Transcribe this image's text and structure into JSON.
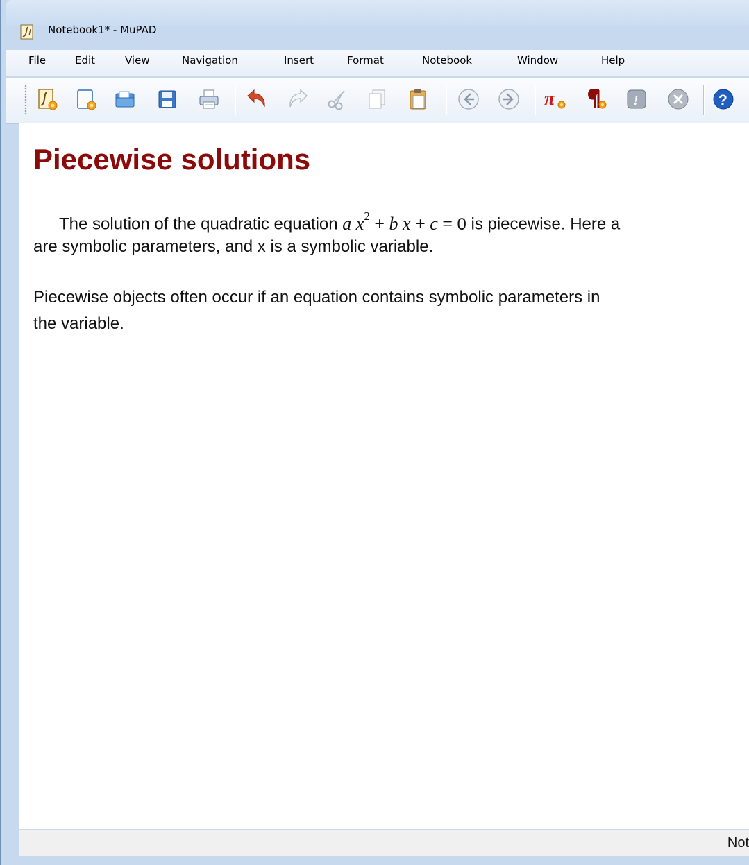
{
  "window": {
    "title": "Notebook1* - MuPAD"
  },
  "menu": {
    "items": [
      "File",
      "Edit",
      "View",
      "Navigation",
      "Insert",
      "Format",
      "Notebook",
      "Window",
      "Help"
    ]
  },
  "toolbar": {
    "buttons": [
      "new-notebook-icon",
      "new-editor-icon",
      "open-icon",
      "save-icon",
      "print-icon",
      "undo-icon",
      "redo-icon",
      "cut-icon",
      "copy-icon",
      "paste-icon",
      "back-icon",
      "forward-icon",
      "insert-calculation-icon",
      "insert-text-paragraph-icon",
      "evaluate-icon",
      "stop-icon",
      "help-icon"
    ]
  },
  "document": {
    "heading": "Piecewise solutions",
    "paragraph1": {
      "before": "The solution of the quadratic equation",
      "eq_a": "a",
      "eq_x": "x",
      "eq_sup": "2",
      "eq_plus1": " + ",
      "eq_b": "b",
      "eq_x2": "x",
      "eq_plus2": " + ",
      "eq_c": "c",
      "eq_eq": " = ",
      "eq_zero": "0",
      "after": " is piecewise. Here a",
      "line2": "are symbolic parameters, and x is a symbolic variable."
    },
    "paragraph2": {
      "line1": "Piecewise objects often occur if an equation contains symbolic parameters in",
      "line2": "the variable."
    }
  },
  "statusbar": {
    "text": "Not"
  },
  "colors": {
    "heading": "#8b0a0a",
    "frame": "#c6d9ef"
  }
}
